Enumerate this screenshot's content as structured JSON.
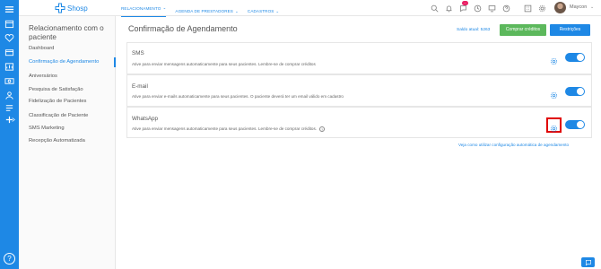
{
  "brand": {
    "name": "Shosp"
  },
  "colors": {
    "accent": "#1e88e5",
    "success": "#5cb85c",
    "highlight": "#e00000",
    "badge": "#e91e63"
  },
  "rail_icons": [
    "home-icon",
    "calendar-icon",
    "heart-icon",
    "wallet-icon",
    "chart-icon",
    "money-icon",
    "users-icon",
    "list-icon",
    "plus-icon",
    "chevron-right-icon"
  ],
  "top_nav": [
    {
      "label": "RELACIONAMENTO"
    },
    {
      "label": "AGENDA DE PRESTADORES"
    },
    {
      "label": "CADASTROS"
    }
  ],
  "notifications": {
    "badge": "..."
  },
  "user": {
    "name": "Maycon"
  },
  "sidebar": {
    "title": "Relacionamento com o paciente",
    "items": [
      {
        "label": "Dashboard"
      },
      {
        "label": "Confirmação de Agendamento"
      },
      {
        "label": "Aniversários"
      },
      {
        "label": "Pesquisa de Satisfação"
      },
      {
        "label": "Fidelização de Pacientes"
      },
      {
        "label": "Classificação de Paciente"
      },
      {
        "label": "SMS Marketing"
      },
      {
        "label": "Recepção Automatizada"
      }
    ]
  },
  "main": {
    "title": "Confirmação de Agendamento",
    "saldo": "Saldo atual: 5263",
    "buy_label": "Comprar créditos",
    "restrict_label": "Restrições",
    "channels": [
      {
        "name": "SMS",
        "description": "Ative para enviar mensagens automaticamente para seus pacientes. Lembre-se de comprar créditos",
        "enabled": true
      },
      {
        "name": "E-mail",
        "description": "Ative para enviar e-mails automaticamente para seus pacientes. O paciente deverá ter um email válido em cadastro",
        "enabled": true
      },
      {
        "name": "WhatsApp",
        "description": "Ative para enviar mensagens automaticamente para seus pacientes. Lembre-se de comprar créditos.",
        "enabled": true
      }
    ],
    "footer_link": "Veja como utilizar configuração automática de agendamento"
  }
}
